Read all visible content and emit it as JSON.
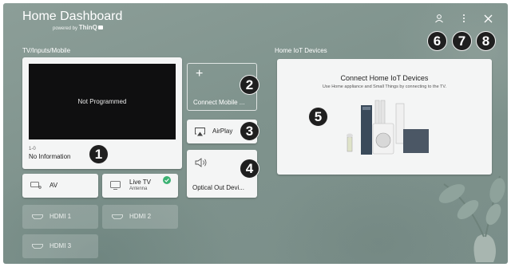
{
  "header": {
    "title": "Home Dashboard",
    "powered_prefix": "powered by",
    "powered_brand": "ThinQ"
  },
  "sections": {
    "inputs_label": "TV/Inputs/Mobile",
    "iot_label": "Home IoT Devices"
  },
  "tv_card": {
    "preview_text": "Not Programmed",
    "channel_number": "1-0",
    "info": "No Information"
  },
  "inputs": {
    "av": "AV",
    "live_tv": "Live TV",
    "live_tv_sub": "Antenna",
    "hdmi1": "HDMI 1",
    "hdmi2": "HDMI 2",
    "hdmi3": "HDMI 3"
  },
  "mobile": {
    "connect_plus": "+",
    "connect_label": "Connect Mobile ...",
    "airplay_label": "AirPlay",
    "optical_label": "Optical Out Devi..."
  },
  "iot": {
    "title": "Connect Home IoT Devices",
    "subtitle": "Use Home appliance and Small Things by connecting to the TV."
  },
  "badges": [
    "1",
    "2",
    "3",
    "4",
    "5",
    "6",
    "7",
    "8"
  ],
  "colors": {
    "background": "#7f938d",
    "card": "#f4f5f5",
    "badge": "#1f1f1f",
    "check": "#3bb273"
  },
  "icons": {
    "profile": "user-icon",
    "menu": "more-vertical-icon",
    "close": "close-icon"
  }
}
